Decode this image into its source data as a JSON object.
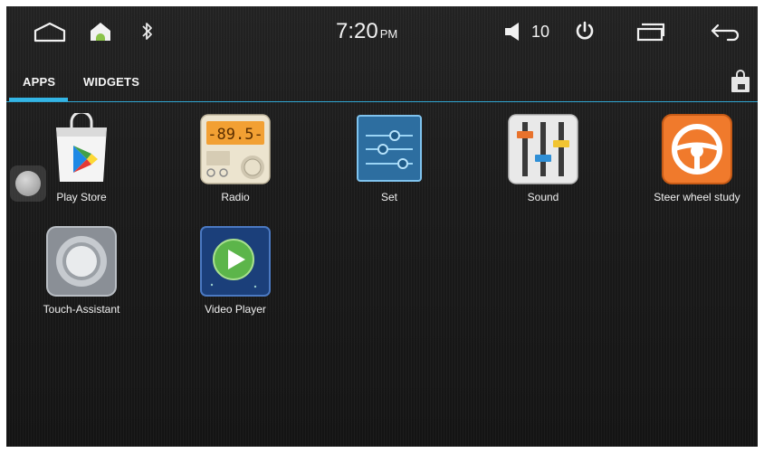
{
  "status_bar": {
    "icons": [
      "home-outline-icon",
      "android-home-icon",
      "bluetooth-icon",
      "speaker-icon",
      "power-icon",
      "recent-apps-icon",
      "back-icon"
    ],
    "time": "7:20",
    "ampm": "PM",
    "volume": "10"
  },
  "tabs": {
    "apps": "APPS",
    "widgets": "WIDGETS",
    "active": "APPS"
  },
  "apps": [
    {
      "label": "Play Store"
    },
    {
      "label": "Radio",
      "display": "-89.5-"
    },
    {
      "label": "Set"
    },
    {
      "label": "Sound"
    },
    {
      "label": "Steer wheel study"
    },
    {
      "label": "Touch-Assistant"
    },
    {
      "label": "Video Player"
    }
  ],
  "colors": {
    "accent": "#33b5e5",
    "background": "#1a1a1a"
  }
}
